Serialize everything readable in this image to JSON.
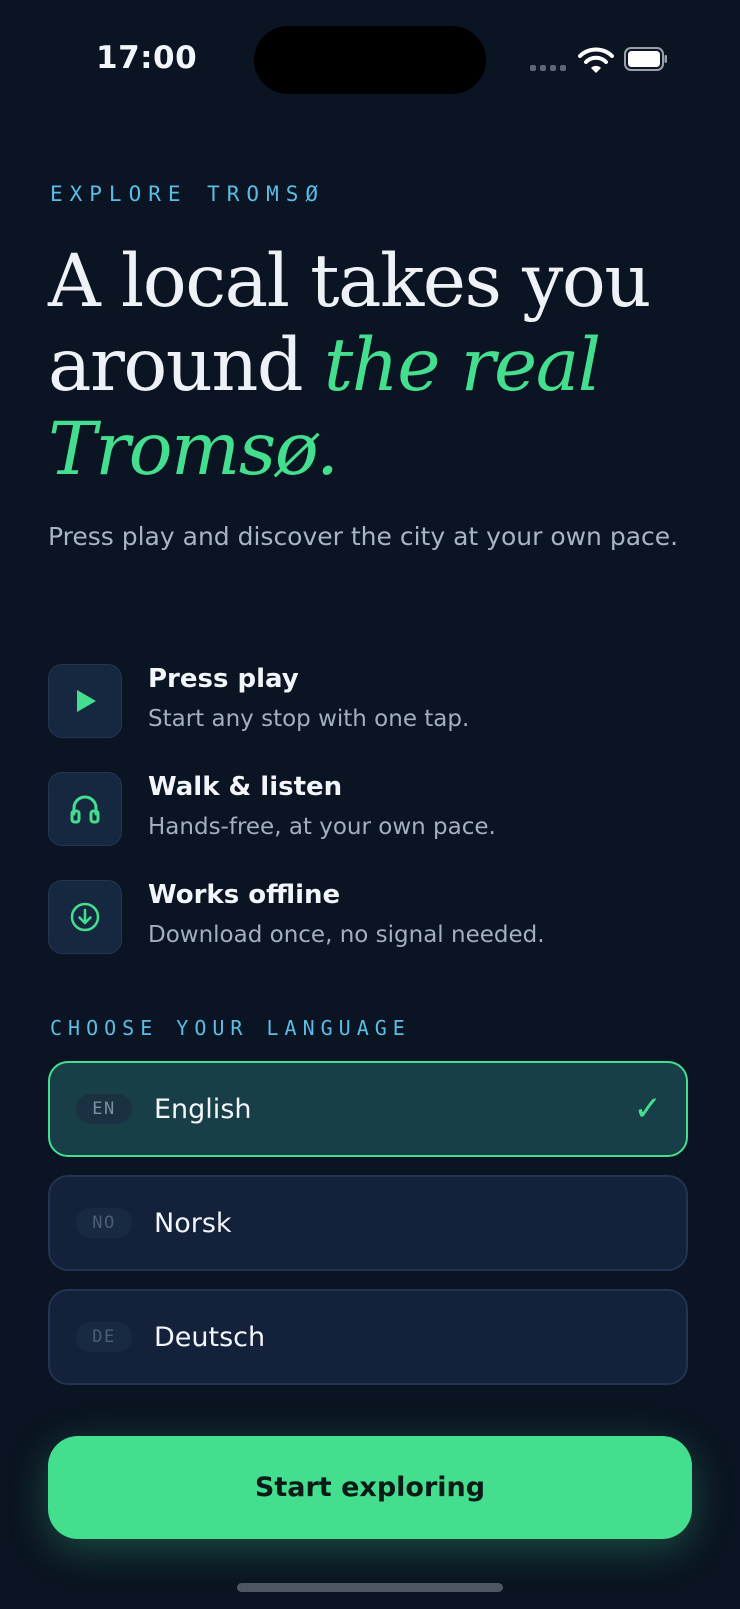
{
  "status_bar": {
    "time": "17:00"
  },
  "hero": {
    "eyebrow": "EXPLORE TROMSØ",
    "headline_part1": "A local takes you around ",
    "headline_accent": "the real Tromsø.",
    "subtitle": "Press play and discover the city at your own pace."
  },
  "features": [
    {
      "icon": "play-icon",
      "title": "Press play",
      "description": "Start any stop with one tap."
    },
    {
      "icon": "headphones-icon",
      "title": "Walk & listen",
      "description": "Hands-free, at your own pace."
    },
    {
      "icon": "download-icon",
      "title": "Works offline",
      "description": "Download once, no signal needed."
    }
  ],
  "language_section": {
    "label": "CHOOSE YOUR LANGUAGE",
    "options": [
      {
        "code": "EN",
        "name": "English",
        "selected": true,
        "check_mark": "✓"
      },
      {
        "code": "NO",
        "name": "Norsk",
        "selected": false
      },
      {
        "code": "DE",
        "name": "Deutsch",
        "selected": false
      }
    ]
  },
  "cta": {
    "label": "Start exploring"
  },
  "colors": {
    "background": "#0b1422",
    "accent_green": "#44de8f",
    "eyebrow_blue": "#5bbde6",
    "card": "#13213b",
    "card_selected": "#183e48"
  }
}
